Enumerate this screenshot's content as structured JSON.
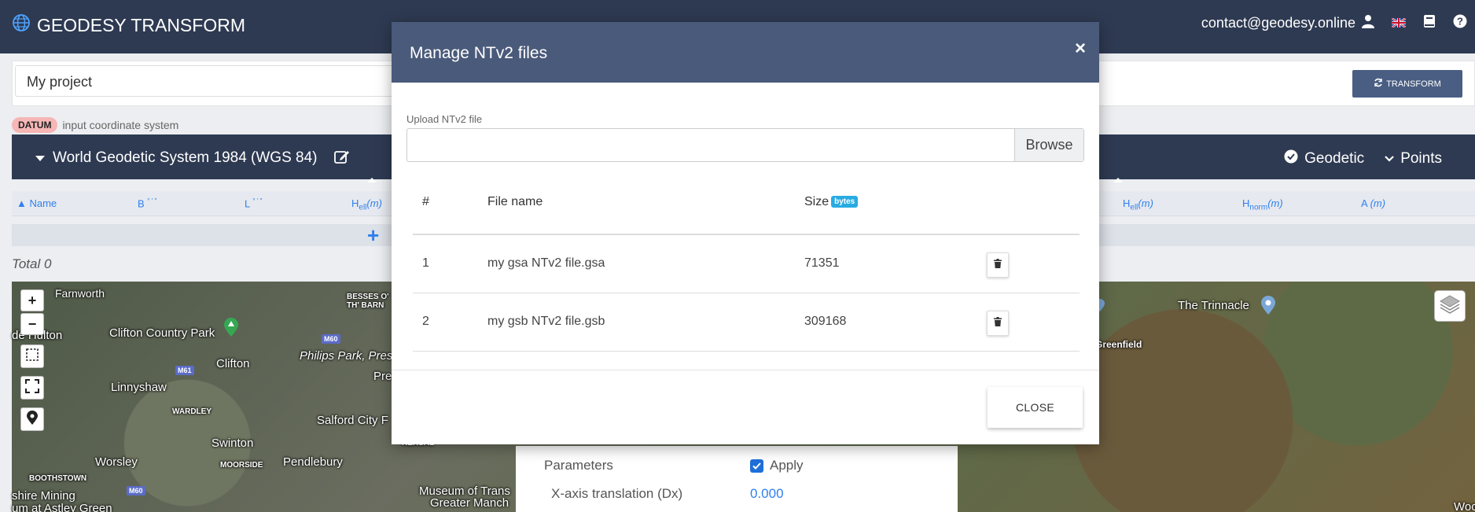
{
  "app": {
    "title": "GEODESY TRANSFORM",
    "email": "contact@geodesy.online"
  },
  "project": {
    "name": "My project",
    "transform_label": "TRANSFORM"
  },
  "datum": {
    "badge": "DATUM",
    "description": "input coordinate system"
  },
  "coordinate_system": {
    "name": "World Geodetic System 1984 (WGS 84)",
    "mode": "Geodetic",
    "input_type": "Points"
  },
  "table": {
    "columns_left": [
      "Name",
      "B",
      "L",
      "H"
    ],
    "columns_right": [
      "H",
      "H",
      "A"
    ],
    "unit_m": "(m)",
    "sub_ell": "ell",
    "sub_norm": "norm",
    "deg_marks": "° ′ ″",
    "add": "+",
    "total": "Total 0"
  },
  "map": {
    "labels": [
      "Farnworth",
      "Clifton Country Park",
      "Clifton",
      "Philips Park, Prestwich",
      "Linnyshaw",
      "WARDLEY",
      "Salford City F",
      "Swinton",
      "Worsley",
      "MOORSIDE",
      "Pendlebury",
      "BOOTHSTOWN",
      "shire Mining",
      "um at Astley Green",
      "Museum of Trans",
      "Greater Manch",
      "BESSES O' TH' BARN",
      "The Trinnacle",
      "Greenfield",
      "Woo",
      "de Hulton",
      "KERSAL",
      "Pre"
    ],
    "road_badges": [
      "M60",
      "M61",
      "M60"
    ],
    "zoom_in": "+",
    "zoom_out": "−"
  },
  "params": {
    "label": "Parameters",
    "apply": "Apply",
    "dx_label": "X-axis translation (Dx)",
    "dx_value": "0.000"
  },
  "modal": {
    "title": "Manage NTv2 files",
    "close_x": "×",
    "upload_label": "Upload NTv2 file",
    "upload_value": "",
    "browse": "Browse",
    "headers": {
      "num": "#",
      "file_name": "File name",
      "size": "Size",
      "size_badge": "bytes"
    },
    "files": [
      {
        "num": "1",
        "name": "my gsa NTv2 file.gsa",
        "size": "71351"
      },
      {
        "num": "2",
        "name": "my gsb NTv2 file.gsb",
        "size": "309168"
      }
    ],
    "close_button": "CLOSE"
  }
}
